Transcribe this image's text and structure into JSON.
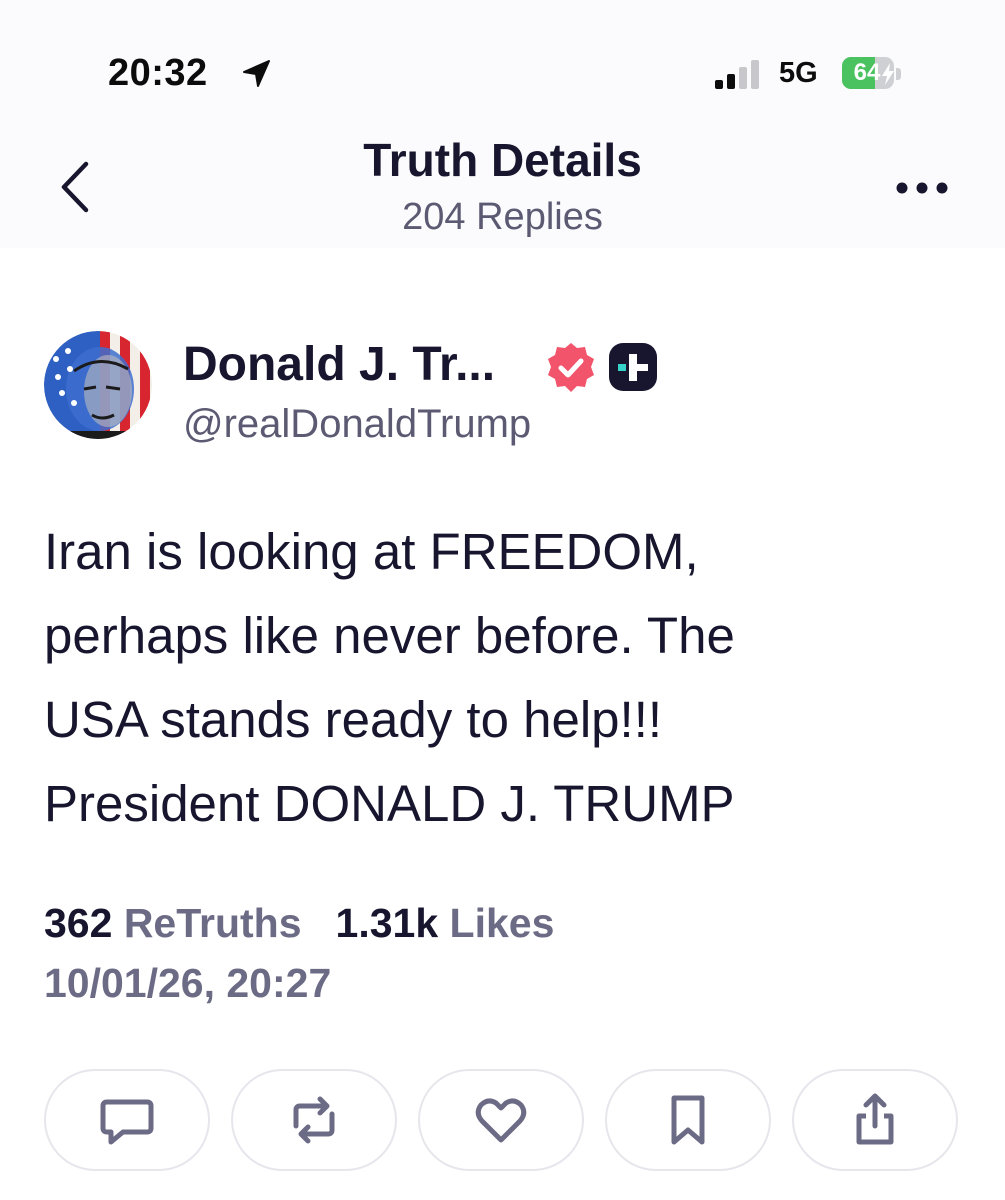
{
  "status_bar": {
    "time": "20:32",
    "network": "5G",
    "battery_percent": 64,
    "battery_label": "64",
    "icons": [
      "location-arrow-icon",
      "cellular-signal-icon",
      "battery-charging-icon"
    ]
  },
  "header": {
    "title": "Truth Details",
    "subtitle": "204 Replies",
    "icons": [
      "chevron-left-icon",
      "more-horizontal-icon"
    ]
  },
  "author": {
    "name": "Donald J. Tr...",
    "handle": "@realDonaldTrump",
    "icons": [
      "verified-badge-icon",
      "truth-plus-badge-icon"
    ]
  },
  "post": {
    "lines": [
      "Iran is looking at FREEDOM,",
      "perhaps like never before. The",
      "USA stands ready to help!!!",
      "President DONALD J. TRUMP"
    ]
  },
  "stats": {
    "retruths_count": "362",
    "retruths_label": "ReTruths",
    "likes_count": "1.31k",
    "likes_label": "Likes",
    "timestamp": "10/01/26, 20:27"
  },
  "actions": [
    "reply-icon",
    "retruth-icon",
    "like-icon",
    "bookmark-icon",
    "share-icon"
  ],
  "colors": {
    "text_primary": "#17162e",
    "text_secondary": "#5b5a72",
    "verified": "#f2546b",
    "battery_fill": "#4bc260"
  }
}
